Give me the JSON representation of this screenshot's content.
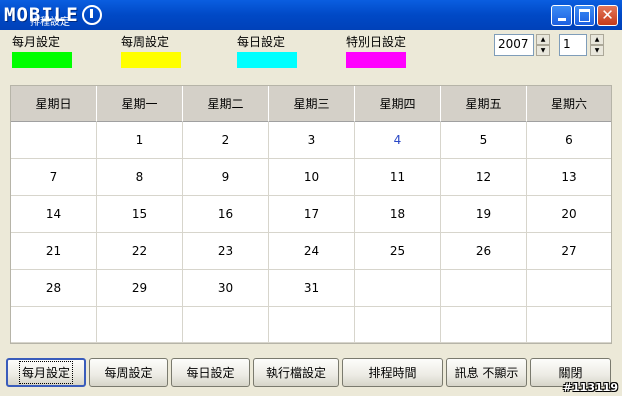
{
  "window": {
    "logo_text": "MOBILE",
    "logo_sub": "排程設定",
    "title": "排程設定"
  },
  "legend": [
    {
      "label": "每月設定",
      "color": "#00ff00"
    },
    {
      "label": "每周設定",
      "color": "#ffff00"
    },
    {
      "label": "每日設定",
      "color": "#00ffff"
    },
    {
      "label": "特別日設定",
      "color": "#ff00ff"
    }
  ],
  "spinners": {
    "year": "2007",
    "month": "1"
  },
  "calendar": {
    "weekdays": [
      "星期日",
      "星期一",
      "星期二",
      "星期三",
      "星期四",
      "星期五",
      "星期六"
    ],
    "today": "4",
    "weeks": [
      [
        "",
        "1",
        "2",
        "3",
        "4",
        "5",
        "6"
      ],
      [
        "7",
        "8",
        "9",
        "10",
        "11",
        "12",
        "13"
      ],
      [
        "14",
        "15",
        "16",
        "17",
        "18",
        "19",
        "20"
      ],
      [
        "21",
        "22",
        "23",
        "24",
        "25",
        "26",
        "27"
      ],
      [
        "28",
        "29",
        "30",
        "31",
        "",
        "",
        ""
      ],
      [
        "",
        "",
        "",
        "",
        "",
        "",
        ""
      ]
    ]
  },
  "buttons": [
    {
      "label": "每月設定"
    },
    {
      "label": "每周設定"
    },
    {
      "label": "每日設定"
    },
    {
      "label": "執行檔設定"
    },
    {
      "label": "排程時間"
    },
    {
      "label": "訊息 不顯示"
    },
    {
      "label": "關閉"
    }
  ],
  "watermark": "#113119"
}
